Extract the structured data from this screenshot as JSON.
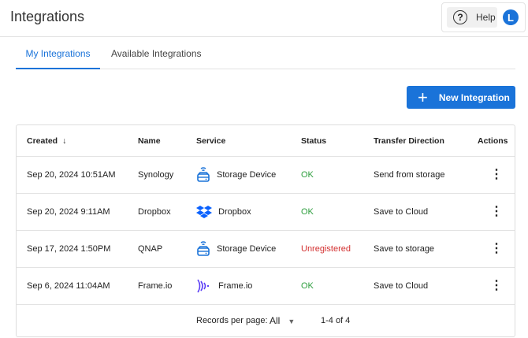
{
  "header": {
    "title": "Integrations",
    "help_label": "Help",
    "avatar_initial": "L"
  },
  "tabs": [
    {
      "label": "My Integrations",
      "active": true
    },
    {
      "label": "Available Integrations",
      "active": false
    }
  ],
  "new_button": {
    "label": "New Integration"
  },
  "table": {
    "columns": [
      "Created",
      "Name",
      "Service",
      "Status",
      "Transfer Direction",
      "Actions"
    ],
    "rows": [
      {
        "created": "Sep 20, 2024 10:51AM",
        "name": "Synology",
        "service": "Storage Device",
        "service_icon": "storage-device",
        "status": "OK",
        "direction": "Send from storage"
      },
      {
        "created": "Sep 20, 2024 9:11AM",
        "name": "Dropbox",
        "service": "Dropbox",
        "service_icon": "dropbox",
        "status": "OK",
        "direction": "Save to Cloud"
      },
      {
        "created": "Sep 17, 2024 1:50PM",
        "name": "QNAP",
        "service": "Storage Device",
        "service_icon": "storage-device",
        "status": "Unregistered",
        "direction": "Save to storage"
      },
      {
        "created": "Sep 6, 2024 11:04AM",
        "name": "Frame.io",
        "service": "Frame.io",
        "service_icon": "frameio",
        "status": "OK",
        "direction": "Save to Cloud"
      }
    ]
  },
  "footer": {
    "records_label": "Records per page:",
    "records_value": "All",
    "range": "1-4 of 4"
  },
  "colors": {
    "accent": "#1a73d9",
    "ok": "#2e9e3e",
    "error": "#d32f2f"
  }
}
